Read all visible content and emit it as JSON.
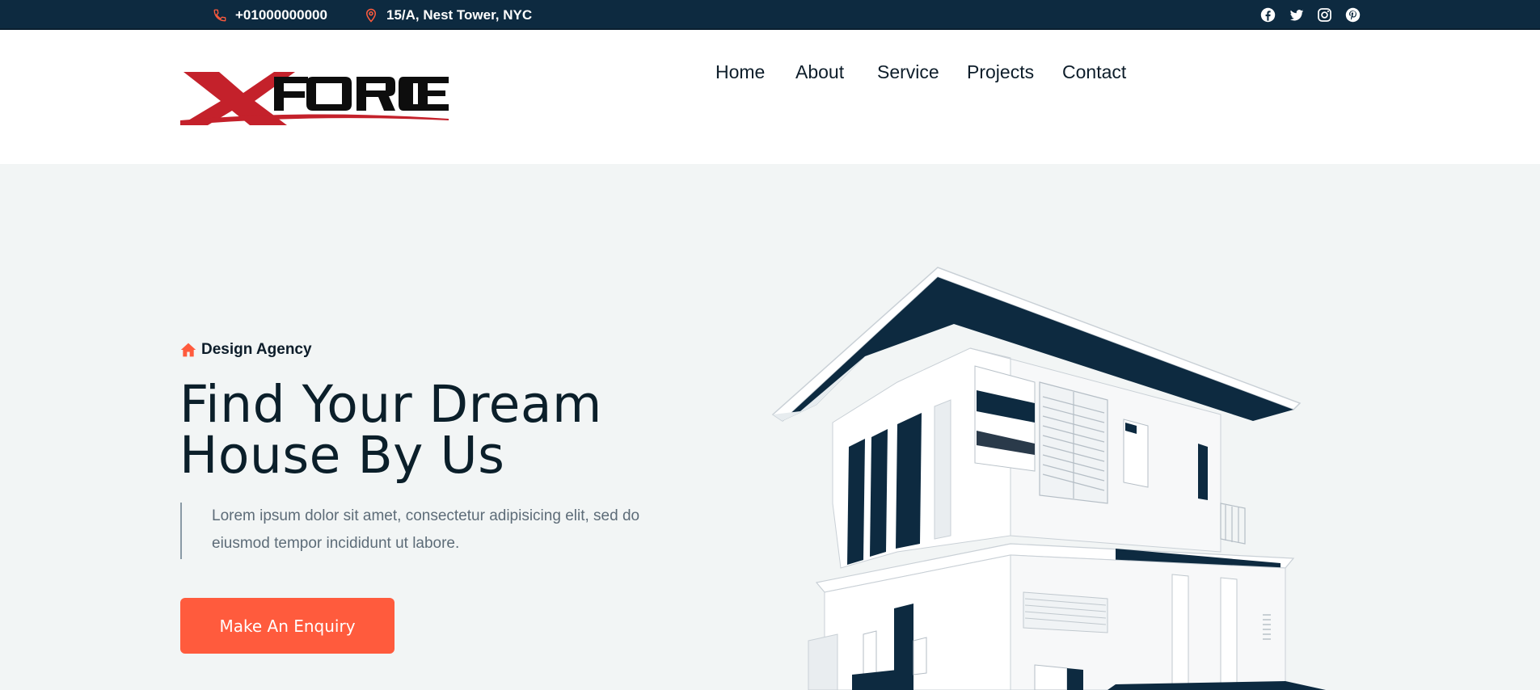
{
  "topbar": {
    "phone": "+01000000000",
    "address": "15/A, Nest Tower, NYC",
    "socials": [
      "facebook-icon",
      "twitter-icon",
      "instagram-icon",
      "pinterest-icon"
    ]
  },
  "header": {
    "logo_text": "XFORCE",
    "nav": [
      "Home",
      "About",
      "Service",
      "Projects",
      "Contact"
    ]
  },
  "hero": {
    "tag": "Design Agency",
    "headline_line1": "Find Your Dream",
    "headline_line2": "House By Us",
    "description_line1": "Lorem ipsum dolor sit amet, consectetur adipisicing elit, sed do",
    "description_line2": "eiusmod tempor incididunt ut labore.",
    "cta_label": "Make An Enquiry"
  },
  "colors": {
    "topbar_bg": "#0d2a40",
    "accent": "#ff5b3d",
    "hero_bg": "#f2f5f5",
    "navy": "#0d2a40"
  }
}
